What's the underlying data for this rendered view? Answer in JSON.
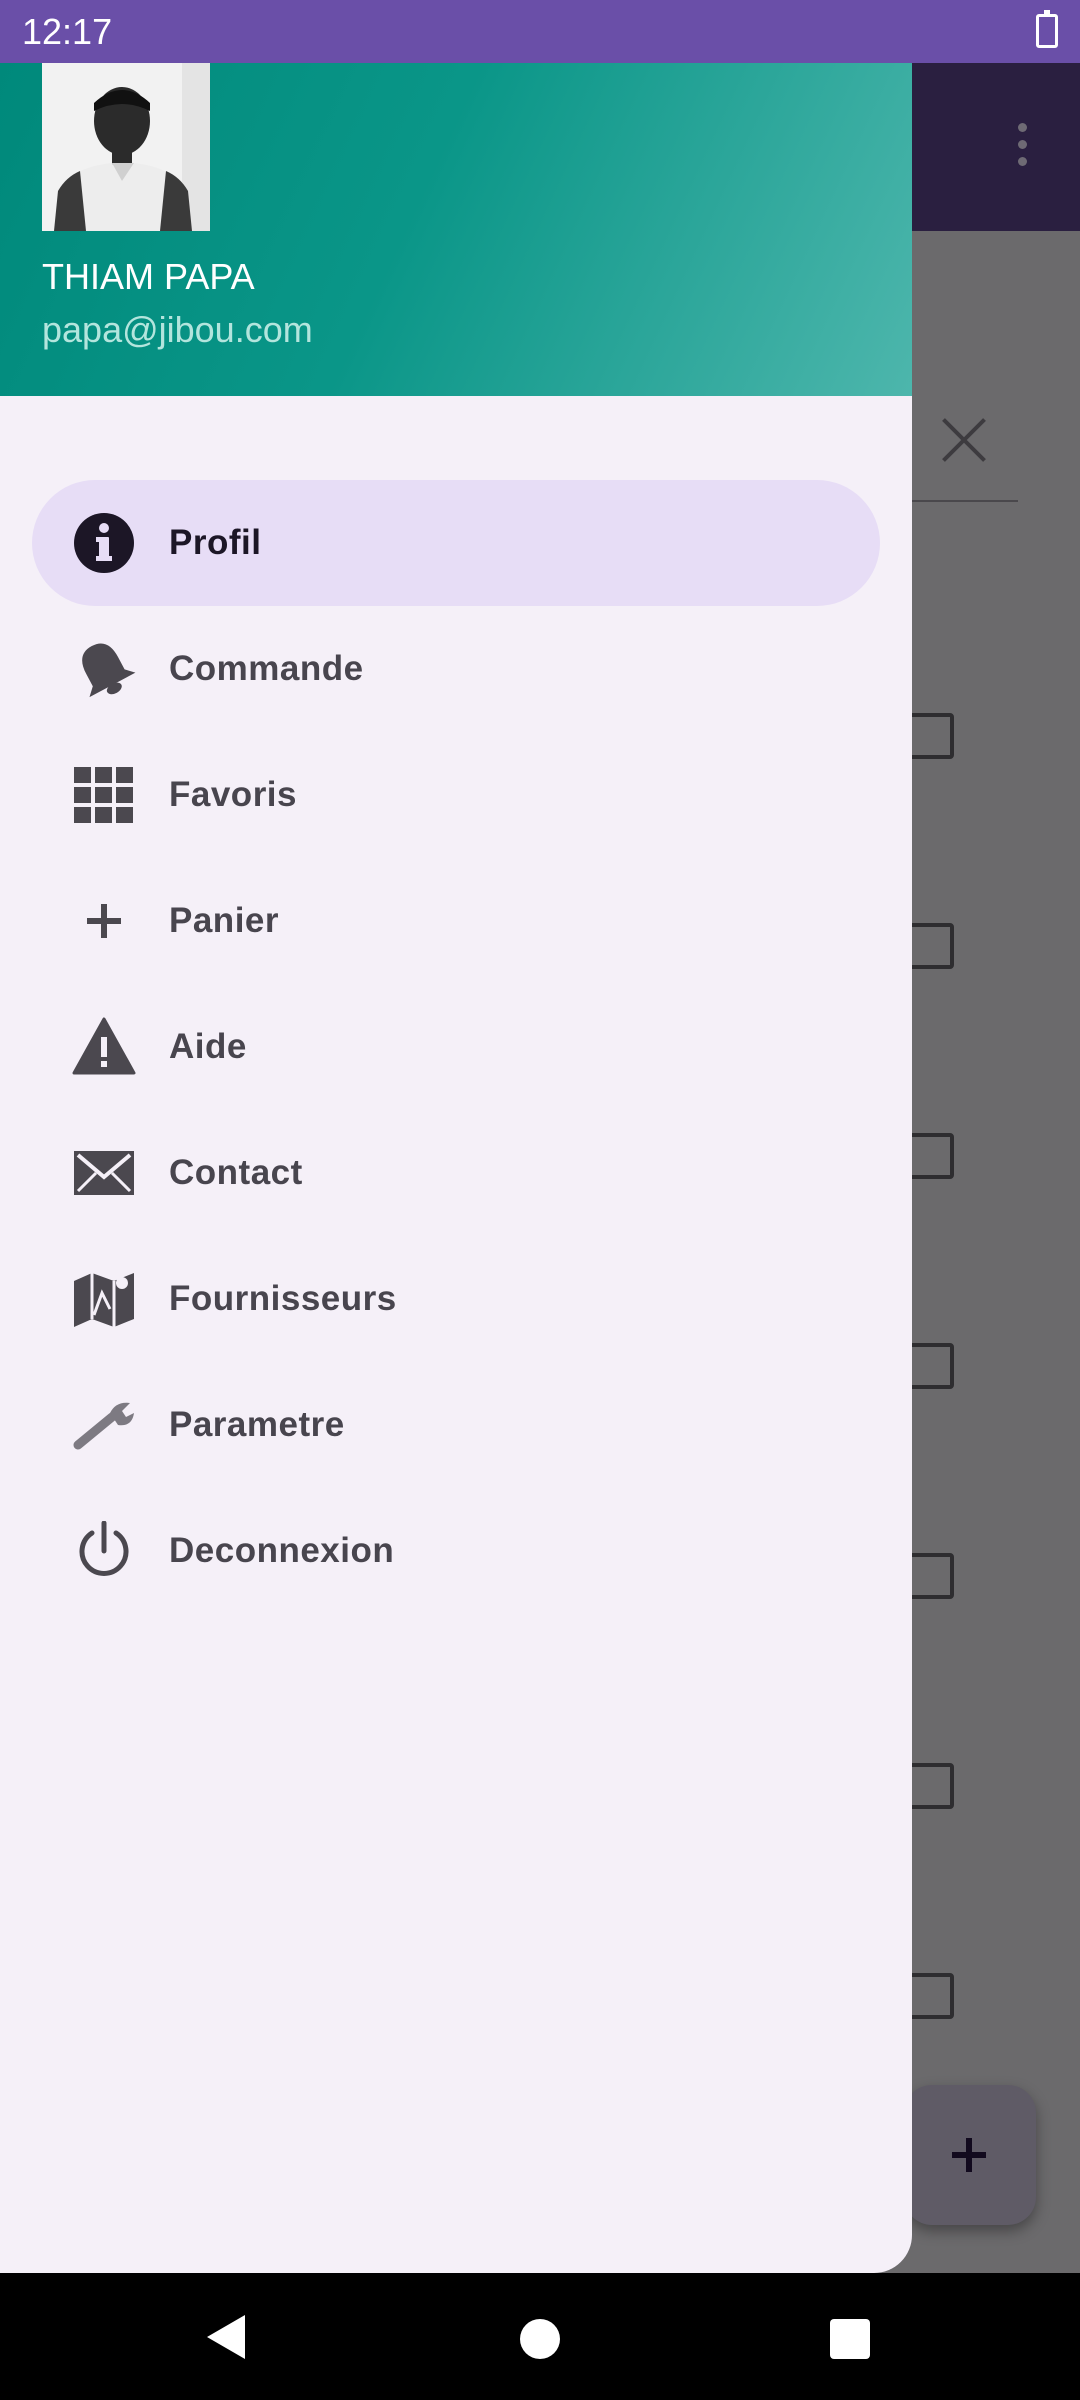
{
  "status_bar": {
    "time": "12:17",
    "battery_icon": "battery-icon"
  },
  "drawer": {
    "header": {
      "name": "THIAM PAPA",
      "email": "papa@jibou.com"
    },
    "items": [
      {
        "label": "Profil",
        "icon": "info-icon",
        "active": true
      },
      {
        "label": "Commande",
        "icon": "bell-icon",
        "active": false
      },
      {
        "label": "Favoris",
        "icon": "grid-icon",
        "active": false
      },
      {
        "label": "Panier",
        "icon": "plus-icon",
        "active": false
      },
      {
        "label": "Aide",
        "icon": "warning-icon",
        "active": false
      },
      {
        "label": "Contact",
        "icon": "mail-icon",
        "active": false
      },
      {
        "label": "Fournisseurs",
        "icon": "map-icon",
        "active": false
      },
      {
        "label": "Parametre",
        "icon": "wrench-icon",
        "active": false
      },
      {
        "label": "Deconnexion",
        "icon": "power-icon",
        "active": false
      }
    ]
  },
  "colors": {
    "status_bar": "#6a4fa8",
    "header_start": "#00897b",
    "header_end": "#4db6ac",
    "drawer_bg": "#f5f0f8",
    "active_item_bg": "#e7ddf6"
  }
}
